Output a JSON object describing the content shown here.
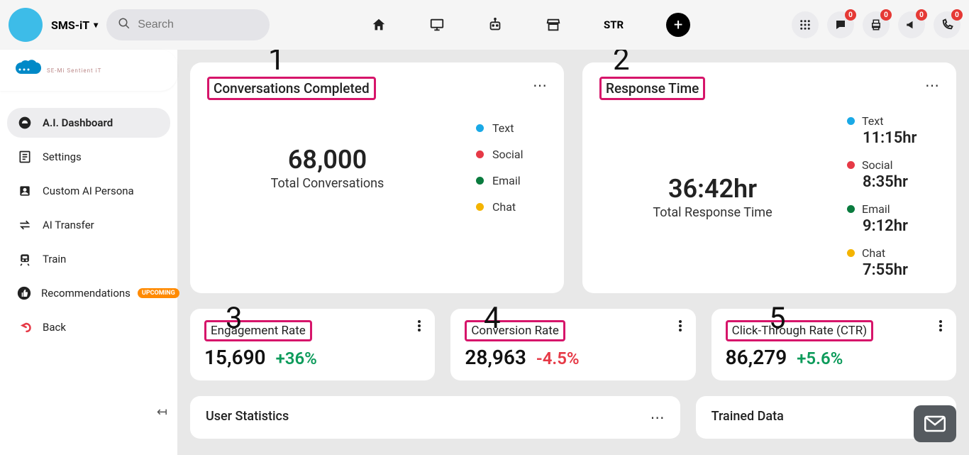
{
  "header": {
    "org_name": "SMS-iT",
    "search_placeholder": "Search",
    "nav_str": "STR",
    "badge": "0"
  },
  "logo": {
    "brand_prefix": "SMS-",
    "brand_suffix": "iT",
    "tagline": "SE-Mi Sentient iT"
  },
  "sidebar": {
    "items": [
      {
        "label": "A.I. Dashboard"
      },
      {
        "label": "Settings"
      },
      {
        "label": "Custom AI Persona"
      },
      {
        "label": "AI Transfer"
      },
      {
        "label": "Train"
      },
      {
        "label": "Recommendations",
        "tag": "UPCOMING"
      },
      {
        "label": "Back"
      }
    ]
  },
  "annotations": {
    "n1": "1",
    "n2": "2",
    "n3": "3",
    "n4": "4",
    "n5": "5"
  },
  "cards": {
    "conversations": {
      "title": "Conversations Completed",
      "value": "68,000",
      "label": "Total Conversations",
      "legend": {
        "text": "Text",
        "social": "Social",
        "email": "Email",
        "chat": "Chat"
      }
    },
    "response": {
      "title": "Response Time",
      "value": "36:42hr",
      "label": "Total Response Time",
      "items": [
        {
          "name": "Text",
          "value": "11:15hr",
          "cls": "text"
        },
        {
          "name": "Social",
          "value": "8:35hr",
          "cls": "social"
        },
        {
          "name": "Email",
          "value": "9:12hr",
          "cls": "email"
        },
        {
          "name": "Chat",
          "value": "7:55hr",
          "cls": "chat"
        }
      ]
    }
  },
  "small_cards": {
    "engagement": {
      "title": "Engagement Rate",
      "value": "15,690",
      "change": "+36%"
    },
    "conversion": {
      "title": "Conversion Rate",
      "value": "28,963",
      "change": "-4.5%"
    },
    "ctr": {
      "title": "Click-Through Rate (CTR)",
      "value": "86,279",
      "change": "+5.6%"
    }
  },
  "bottom": {
    "user_stats": "User Statistics",
    "trained_data": "Trained Data"
  }
}
